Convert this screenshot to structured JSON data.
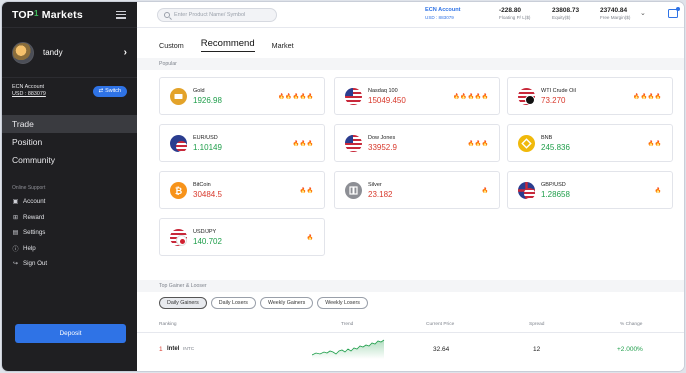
{
  "app": {
    "logo_prefix": "TOP",
    "logo_mark": "1",
    "logo_suffix": " Markets"
  },
  "user": {
    "name": "tandy"
  },
  "account": {
    "label": "ECN Account",
    "number": "USD : 883079",
    "switch_label": "Switch"
  },
  "nav": [
    {
      "label": "Trade",
      "active": true
    },
    {
      "label": "Position",
      "active": false
    },
    {
      "label": "Community",
      "active": false
    }
  ],
  "support": {
    "title": "Online Support",
    "items": [
      {
        "label": "Account",
        "icon": "account-icon"
      },
      {
        "label": "Reward",
        "icon": "gift-icon"
      },
      {
        "label": "Settings",
        "icon": "settings-icon"
      },
      {
        "label": "Help",
        "icon": "help-icon"
      },
      {
        "label": "Sign Out",
        "icon": "signout-icon"
      }
    ]
  },
  "deposit_label": "Deposit",
  "search": {
    "placeholder": "Enter Product Name/ Symbol"
  },
  "topstats": {
    "ecn_title": "ECN Account",
    "ecn_sub": "USD : 883079",
    "floating": {
      "value": "-228.80",
      "label": "Floating P/ L($)"
    },
    "equity": {
      "value": "23808.73",
      "label": "Equity($)"
    },
    "free_margin": {
      "value": "23740.84",
      "label": "Free Margin($)"
    }
  },
  "tabs": [
    {
      "label": "Custom",
      "active": false
    },
    {
      "label": "Recommend",
      "active": true
    },
    {
      "label": "Market",
      "active": false
    }
  ],
  "popular": {
    "title": "Popular",
    "items": [
      {
        "name": "Gold",
        "price": "1926.98",
        "trend": "green",
        "heat": 5,
        "icon": "gold-bar-icon"
      },
      {
        "name": "Nasdaq 100",
        "price": "15049.450",
        "trend": "red",
        "heat": 5,
        "icon": "us-flag-icon"
      },
      {
        "name": "WTI Crude Oil",
        "price": "73.270",
        "trend": "red",
        "heat": 4,
        "icon": "oil-icon"
      },
      {
        "name": "EUR/USD",
        "price": "1.10149",
        "trend": "green",
        "heat": 3,
        "icon": "eur-usd-flag-icon"
      },
      {
        "name": "Dow Jones",
        "price": "33952.9",
        "trend": "red",
        "heat": 3,
        "icon": "us-flag-icon"
      },
      {
        "name": "BNB",
        "price": "245.836",
        "trend": "green",
        "heat": 2,
        "icon": "bnb-icon"
      },
      {
        "name": "BitCoin",
        "price": "30484.5",
        "trend": "red",
        "heat": 2,
        "icon": "bitcoin-icon"
      },
      {
        "name": "Silver",
        "price": "23.182",
        "trend": "red",
        "heat": 1,
        "icon": "silver-icon"
      },
      {
        "name": "GBP/USD",
        "price": "1.28658",
        "trend": "green",
        "heat": 1,
        "icon": "gbp-usd-flag-icon"
      },
      {
        "name": "USD/JPY",
        "price": "140.702",
        "trend": "green",
        "heat": 1,
        "icon": "usd-jpy-flag-icon"
      }
    ]
  },
  "gainers": {
    "title": "Top Gainer & Looser",
    "chips": [
      {
        "label": "Daily Gainers",
        "active": true
      },
      {
        "label": "Daily Losers",
        "active": false
      },
      {
        "label": "Weekly Gainers",
        "active": false
      },
      {
        "label": "Weekly Losers",
        "active": false
      }
    ],
    "headers": {
      "ranking": "Ranking",
      "trend": "Trend",
      "price": "Current Price",
      "spread": "Spread",
      "change": "% Change"
    },
    "rows": [
      {
        "rank": "1",
        "name": "Intel",
        "symbol": "INTC",
        "price": "32.64",
        "spread": "12",
        "change": "+2.000%"
      }
    ]
  },
  "colors": {
    "accent": "#2f73e6",
    "up": "#1e9e4a",
    "down": "#d8382b",
    "sidebar": "#1f1f22"
  }
}
